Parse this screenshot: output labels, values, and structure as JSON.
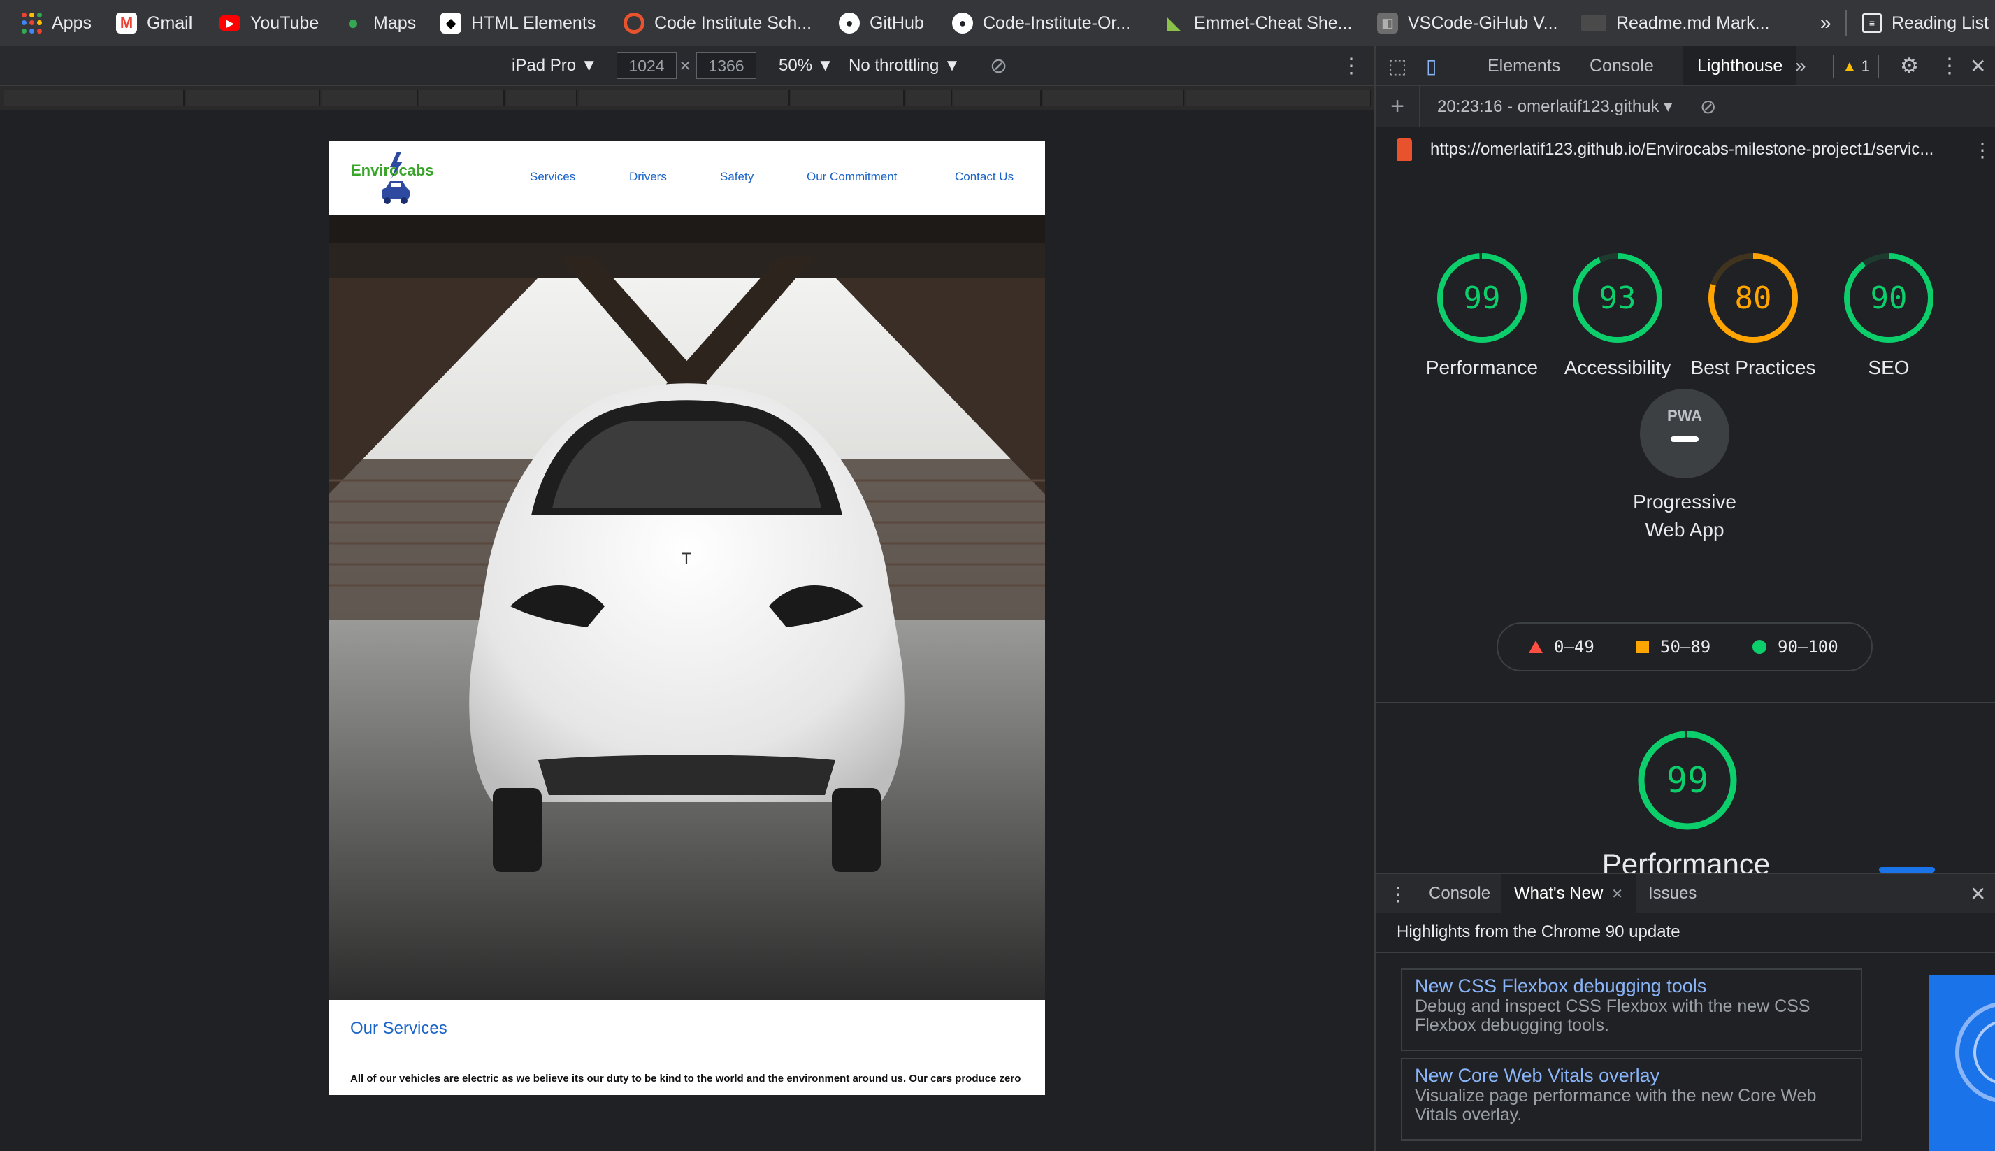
{
  "bookmarks": [
    {
      "label": "Apps",
      "icon": "apps-grid-icon"
    },
    {
      "label": "Gmail",
      "icon": "gmail-icon"
    },
    {
      "label": "YouTube",
      "icon": "youtube-icon"
    },
    {
      "label": "Maps",
      "icon": "maps-pin-icon"
    },
    {
      "label": "HTML Elements",
      "icon": "html-elements-icon"
    },
    {
      "label": "Code Institute Sch...",
      "icon": "code-institute-icon"
    },
    {
      "label": "GitHub",
      "icon": "github-icon"
    },
    {
      "label": "Code-Institute-Or...",
      "icon": "github-icon"
    },
    {
      "label": "Emmet-Cheat She...",
      "icon": "emmet-icon"
    },
    {
      "label": "VSCode-GiHub V...",
      "icon": "vscode-cube-icon"
    },
    {
      "label": "Readme.md Mark...",
      "icon": "readme-icon"
    }
  ],
  "bookmarks_overflow": "»",
  "reading_list": "Reading List",
  "device_toolbar": {
    "device": "iPad Pro ▼",
    "width": "1024",
    "times": "×",
    "height": "1366",
    "zoom": "50% ▼",
    "throttling": "No throttling ▼"
  },
  "site": {
    "logo_text": "Envirocabs",
    "nav": [
      "Services",
      "Drivers",
      "Safety",
      "Our Commitment",
      "Contact Us"
    ],
    "section_title": "Our Services",
    "section_text": "All of our vehicles are electric as we believe its our duty to be kind to the world and the environment around us. Our cars produce zero"
  },
  "devtools": {
    "tabs": [
      "Elements",
      "Console",
      "Lighthouse"
    ],
    "active_tab": "Lighthouse",
    "more_tabs": "»",
    "warning_count": "1",
    "lighthouse_bar": {
      "plus": "+",
      "report_label": "20:23:16 - omerlatif123.githuk ▾"
    },
    "url": "https://omerlatif123.github.io/Envirocabs-milestone-project1/servic...",
    "scores": [
      {
        "value": "99",
        "label": "Performance",
        "color": "#0cce6b",
        "fraction": 0.99
      },
      {
        "value": "93",
        "label": "Accessibility",
        "color": "#0cce6b",
        "fraction": 0.93
      },
      {
        "value": "80",
        "label": "Best Practices",
        "color": "#ffa400",
        "fraction": 0.8
      },
      {
        "value": "90",
        "label": "SEO",
        "color": "#0cce6b",
        "fraction": 0.9
      }
    ],
    "pwa": {
      "badge": "PWA",
      "label": "Progressive Web App"
    },
    "legend": [
      {
        "range": "0–49",
        "color": "#ff4e42"
      },
      {
        "range": "50–89",
        "color": "#ffa400"
      },
      {
        "range": "90–100",
        "color": "#0cce6b"
      }
    ],
    "big_score": {
      "value": "99",
      "label": "Performance",
      "fraction": 0.99
    },
    "drawer_tabs": [
      "Console",
      "What's New",
      "Issues"
    ],
    "drawer_active": "What's New",
    "drawer_heading": "Highlights from the Chrome 90 update",
    "whats_new": [
      {
        "title": "New CSS Flexbox debugging tools",
        "desc": "Debug and inspect CSS Flexbox with the new CSS Flexbox debugging tools."
      },
      {
        "title": "New Core Web Vitals overlay",
        "desc": "Visualize page performance with the new Core Web Vitals overlay."
      }
    ]
  }
}
